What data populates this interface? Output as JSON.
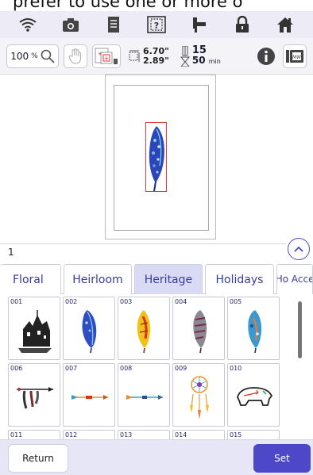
{
  "header_text": "prefer to use one or more o",
  "status_bar": {
    "icons": [
      "wifi-icon",
      "camera-icon",
      "document-icon",
      "help-icon",
      "thread-icon",
      "lock-icon",
      "home-icon"
    ]
  },
  "toolbar": {
    "zoom": "100",
    "zoom_unit": "%",
    "width": "6.70\"",
    "height": "2.89\"",
    "time_top": "15",
    "time_bottom": "50",
    "time_unit": "min"
  },
  "page_number": "1",
  "tabs": [
    {
      "label": "Floral"
    },
    {
      "label": "Heirloom"
    },
    {
      "label": "Heritage"
    },
    {
      "label": "Holidays"
    },
    {
      "label": "Ho Acce"
    }
  ],
  "designs": [
    {
      "id": "001",
      "icon": "house-cluster-icon"
    },
    {
      "id": "002",
      "icon": "feather-blue-icon"
    },
    {
      "id": "003",
      "icon": "feather-yellow-icon"
    },
    {
      "id": "004",
      "icon": "feather-gray-icon"
    },
    {
      "id": "005",
      "icon": "feather-teal-icon"
    },
    {
      "id": "006",
      "icon": "arrow-feathers-icon"
    },
    {
      "id": "007",
      "icon": "arrow-orange-icon"
    },
    {
      "id": "008",
      "icon": "arrow-teal-icon"
    },
    {
      "id": "009",
      "icon": "dreamcatcher-icon"
    },
    {
      "id": "010",
      "icon": "bear-icon"
    },
    {
      "id": "011",
      "icon": "design-icon"
    },
    {
      "id": "012",
      "icon": "design-icon"
    },
    {
      "id": "013",
      "icon": "design-icon"
    },
    {
      "id": "014",
      "icon": "design-icon"
    },
    {
      "id": "015",
      "icon": "design-icon"
    }
  ],
  "buttons": {
    "return": "Return",
    "set": "Set"
  },
  "colors": {
    "accent": "#4c48c8",
    "tab_active": "#d9daf3",
    "status_bg": "#ecebf6",
    "frame_red": "#e03a3a"
  }
}
